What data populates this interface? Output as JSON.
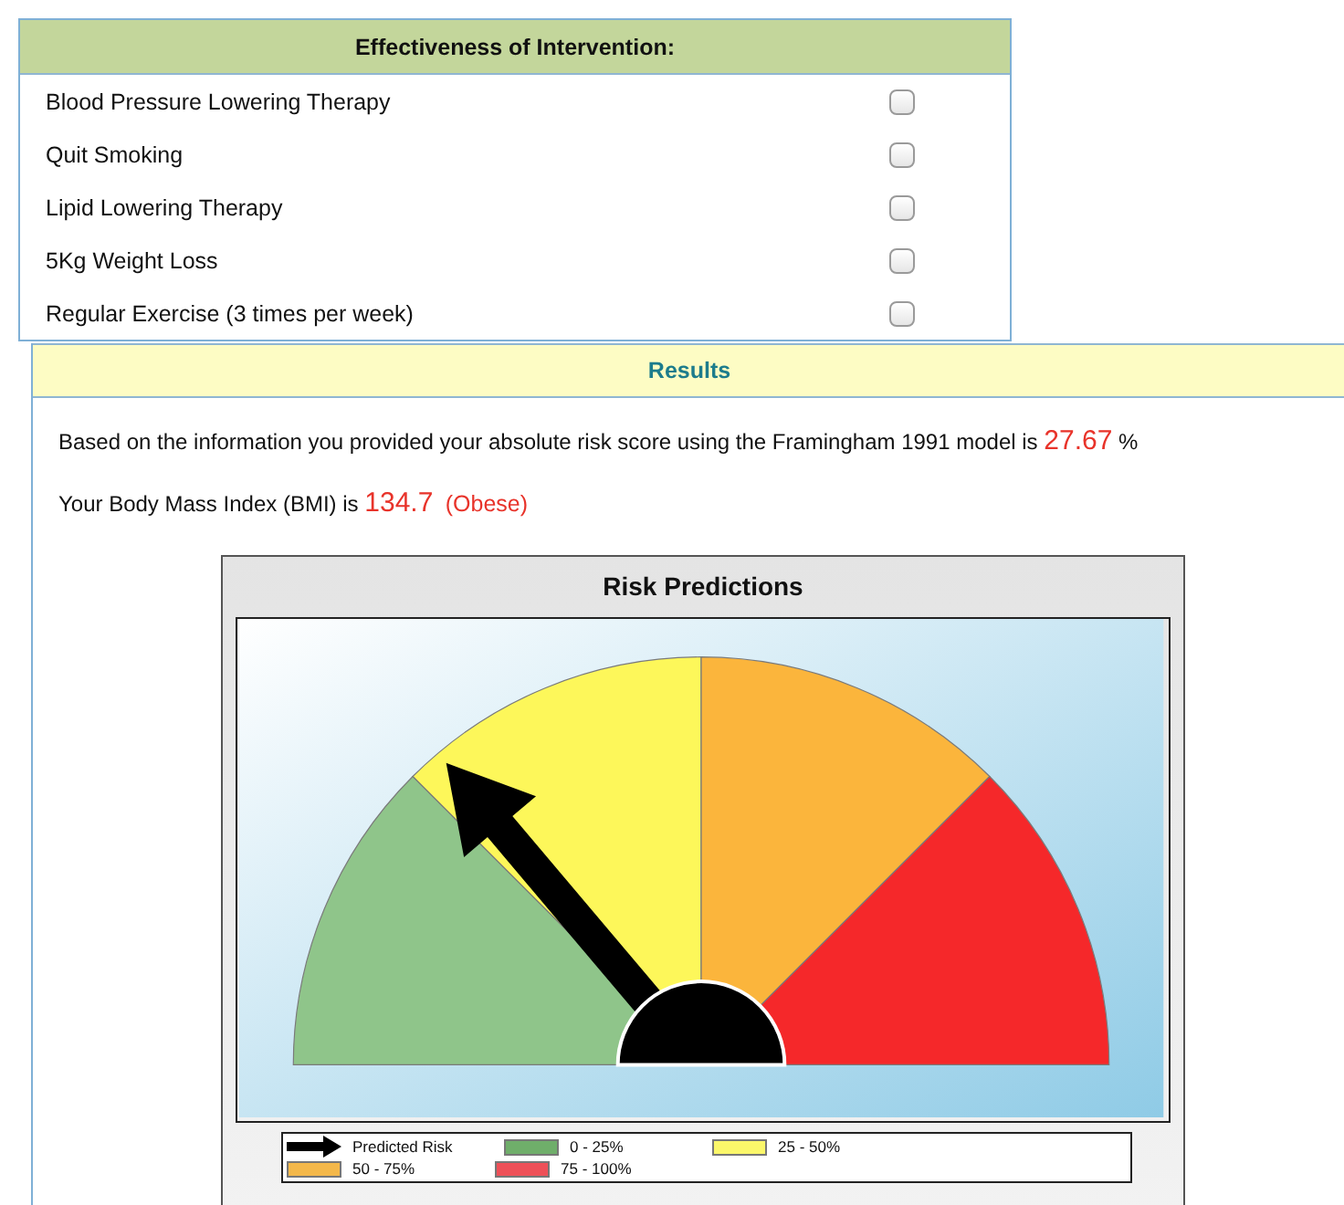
{
  "intervention": {
    "title": "Effectiveness of Intervention:",
    "options": [
      {
        "label": "Blood Pressure Lowering Therapy",
        "checked": false
      },
      {
        "label": "Quit Smoking",
        "checked": false
      },
      {
        "label": "Lipid Lowering Therapy",
        "checked": false
      },
      {
        "label": "5Kg Weight Loss",
        "checked": false
      },
      {
        "label": "Regular Exercise (3 times per week)",
        "checked": false
      }
    ]
  },
  "results": {
    "title": "Results",
    "risk_text": "Based on the information you provided your absolute risk score using the Framingham 1991 model is",
    "risk_value": "27.67",
    "risk_unit": "%",
    "bmi_text": "Your Body Mass Index (BMI) is",
    "bmi_value": "134.7",
    "bmi_category": "(Obese)"
  },
  "chart": {
    "title": "Risk Predictions",
    "segments": [
      {
        "color": "#8fc58a"
      },
      {
        "color": "#fdf75a"
      },
      {
        "color": "#fbb53c"
      },
      {
        "color": "#f5282a"
      }
    ],
    "legend": [
      {
        "kind": "arrow",
        "label": "Predicted Risk"
      },
      {
        "kind": "swatch",
        "color": "#6fae6a",
        "label": "0 - 25%"
      },
      {
        "kind": "swatch",
        "color": "#fbf76a",
        "label": "25 - 50%"
      },
      {
        "kind": "swatch",
        "color": "#f4b84a",
        "label": "50 - 75%"
      },
      {
        "kind": "swatch",
        "color": "#ee5058",
        "label": "75 - 100%"
      }
    ]
  }
}
